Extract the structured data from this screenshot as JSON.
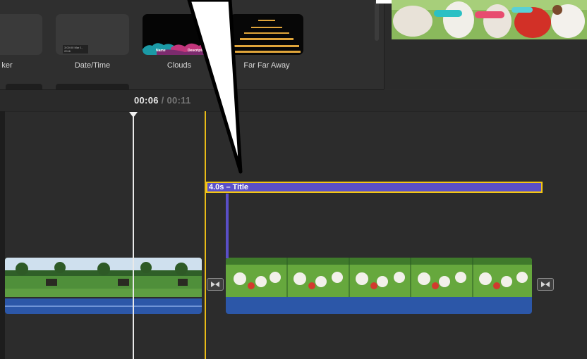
{
  "browser": {
    "tiles": [
      {
        "label": "ker"
      },
      {
        "label": "Date/Time",
        "thumb_text": "3:00:00 Mar 1, 2016"
      },
      {
        "label": "Clouds",
        "thumb_words": [
          "Name",
          "Description"
        ]
      },
      {
        "label": "Far Far Away"
      }
    ]
  },
  "timeline": {
    "current_time": "00:06",
    "separator": "/",
    "total_time": "00:11",
    "title_clip": {
      "label": "4.0s – Title"
    }
  },
  "colors": {
    "title_clip": "#5a4fc8",
    "selection_outline": "#f3c614",
    "audio_track": "#2c57a8",
    "skimmer": "#e9bb17"
  }
}
